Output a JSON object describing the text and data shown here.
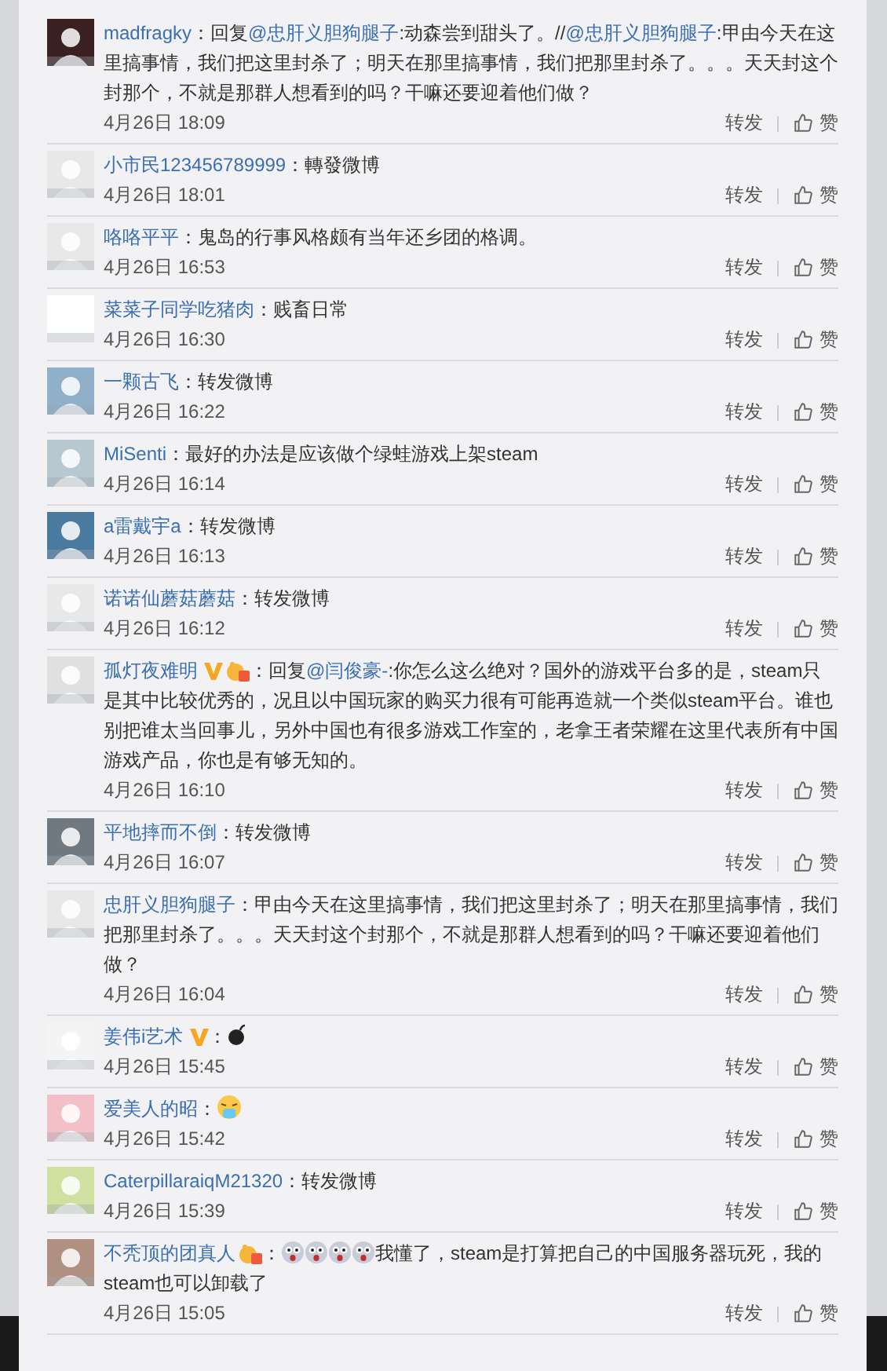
{
  "comments": [
    {
      "user": "madfragky",
      "sep": "：",
      "content": [
        {
          "kind": "text",
          "text": "回复"
        },
        {
          "kind": "mention",
          "text": "@忠肝义胆狗腿子"
        },
        {
          "kind": "text",
          "text": ":动森尝到甜头了。//"
        },
        {
          "kind": "mention",
          "text": "@忠肝义胆狗腿子"
        },
        {
          "kind": "text",
          "text": ":甲由今天在这里搞事情，我们把这里封杀了；明天在那里搞事情，我们把那里封杀了。。。天天封这个封那个，不就是那群人想看到的吗？干嘛还要迎着他们做？"
        }
      ],
      "time": "4月26日 18:09",
      "repost": "转发",
      "like": "赞"
    },
    {
      "user": "小市民123456789999",
      "sep": "：",
      "content": [
        {
          "kind": "text",
          "text": "轉發微博"
        }
      ],
      "time": "4月26日 18:01",
      "repost": "转发",
      "like": "赞"
    },
    {
      "user": "咯咯平平",
      "sep": "：",
      "content": [
        {
          "kind": "text",
          "text": "鬼岛的行事风格颇有当年还乡团的格调。"
        }
      ],
      "time": "4月26日 16:53",
      "repost": "转发",
      "like": "赞"
    },
    {
      "user": "菜菜子同学吃猪肉",
      "sep": "：",
      "content": [
        {
          "kind": "text",
          "text": "贱畜日常"
        }
      ],
      "time": "4月26日 16:30",
      "repost": "转发",
      "like": "赞"
    },
    {
      "user": "一颗古飞",
      "sep": "：",
      "content": [
        {
          "kind": "text",
          "text": "转发微博"
        }
      ],
      "time": "4月26日 16:22",
      "repost": "转发",
      "like": "赞"
    },
    {
      "user": "MiSenti",
      "sep": "：",
      "content": [
        {
          "kind": "text",
          "text": "最好的办法是应该做个绿蛙游戏上架steam"
        }
      ],
      "time": "4月26日 16:14",
      "repost": "转发",
      "like": "赞"
    },
    {
      "user": "a雷戴宇a",
      "sep": "：",
      "content": [
        {
          "kind": "text",
          "text": "转发微博"
        }
      ],
      "time": "4月26日 16:13",
      "repost": "转发",
      "like": "赞"
    },
    {
      "user": "诺诺仙蘑菇蘑菇",
      "sep": "：",
      "content": [
        {
          "kind": "text",
          "text": "转发微博"
        }
      ],
      "time": "4月26日 16:12",
      "repost": "转发",
      "like": "赞"
    },
    {
      "user": "孤灯夜难明",
      "badges": [
        {
          "kind": "verified"
        },
        {
          "kind": "vip"
        }
      ],
      "sep": "：",
      "content": [
        {
          "kind": "text",
          "text": "回复"
        },
        {
          "kind": "mention",
          "text": "@闫俊豪-"
        },
        {
          "kind": "text",
          "text": ":你怎么这么绝对？国外的游戏平台多的是，steam只是其中比较优秀的，况且以中国玩家的购买力很有可能再造就一个类似steam平台。谁也别把谁太当回事儿，另外中国也有很多游戏工作室的，老拿王者荣耀在这里代表所有中国游戏产品，你也是有够无知的。"
        }
      ],
      "time": "4月26日 16:10",
      "repost": "转发",
      "like": "赞"
    },
    {
      "user": "平地摔而不倒",
      "sep": "：",
      "content": [
        {
          "kind": "text",
          "text": "转发微博"
        }
      ],
      "time": "4月26日 16:07",
      "repost": "转发",
      "like": "赞"
    },
    {
      "user": "忠肝义胆狗腿子",
      "sep": "：",
      "content": [
        {
          "kind": "text",
          "text": "甲由今天在这里搞事情，我们把这里封杀了；明天在那里搞事情，我们把那里封杀了。。。天天封这个封那个，不就是那群人想看到的吗？干嘛还要迎着他们做？"
        }
      ],
      "time": "4月26日 16:04",
      "repost": "转发",
      "like": "赞"
    },
    {
      "user": "姜伟i艺术",
      "badges": [
        {
          "kind": "verified"
        }
      ],
      "sep": "：",
      "content": [
        {
          "kind": "bomb"
        }
      ],
      "time": "4月26日 15:45",
      "repost": "转发",
      "like": "赞"
    },
    {
      "user": "爱美人的昭",
      "sep": "：",
      "content": [
        {
          "kind": "drool"
        }
      ],
      "time": "4月26日 15:42",
      "repost": "转发",
      "like": "赞"
    },
    {
      "user": "CaterpillaraiqM21320",
      "sep": "：",
      "content": [
        {
          "kind": "text",
          "text": "转发微博"
        }
      ],
      "time": "4月26日 15:39",
      "repost": "转发",
      "like": "赞"
    },
    {
      "user": "不秃顶的团真人",
      "badges": [
        {
          "kind": "vip"
        }
      ],
      "sep": "：",
      "content": [
        {
          "kind": "shock"
        },
        {
          "kind": "shock"
        },
        {
          "kind": "shock"
        },
        {
          "kind": "shock"
        },
        {
          "kind": "text",
          "text": "我懂了，steam是打算把自己的中国服务器玩死，我的steam也可以卸载了"
        }
      ],
      "time": "4月26日 15:05",
      "repost": "转发",
      "like": "赞"
    }
  ]
}
